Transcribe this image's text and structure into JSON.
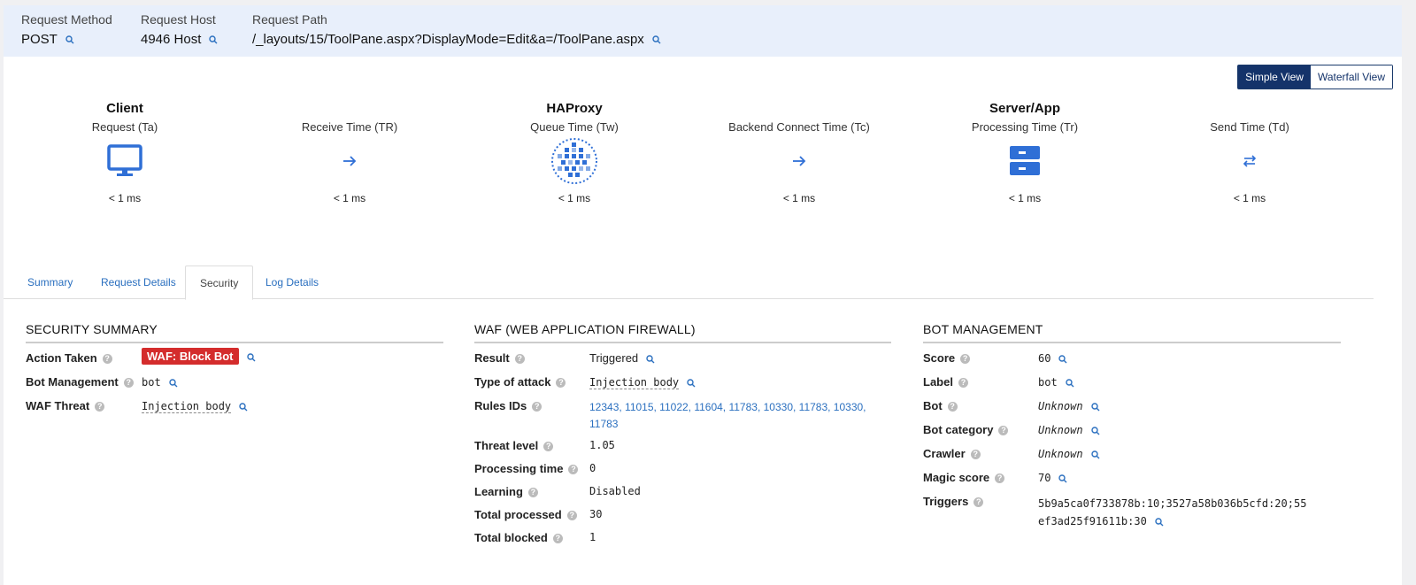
{
  "request": {
    "method": {
      "label": "Request Method",
      "value": "POST"
    },
    "host": {
      "label": "Request Host",
      "value": "4946 Host"
    },
    "path": {
      "label": "Request Path",
      "value": "/_layouts/15/ToolPane.aspx?DisplayMode=Edit&a=/ToolPane.aspx"
    }
  },
  "view_toggle": {
    "simple": "Simple View",
    "waterfall": "Waterfall View",
    "active": "simple"
  },
  "flow": [
    {
      "name": "Client",
      "sub": "Request (Ta)",
      "icon": "monitor-icon",
      "time": "< 1 ms"
    },
    {
      "name": "",
      "sub": "Receive Time (TR)",
      "icon": "arrow-right-icon",
      "time": "< 1 ms"
    },
    {
      "name": "HAProxy",
      "sub": "Queue Time (Tw)",
      "icon": "haproxy-logo-icon",
      "time": "< 1 ms"
    },
    {
      "name": "",
      "sub": "Backend Connect Time (Tc)",
      "icon": "arrow-right-icon",
      "time": "< 1 ms"
    },
    {
      "name": "Server/App",
      "sub": "Processing Time (Tr)",
      "icon": "server-icon",
      "time": "< 1 ms"
    },
    {
      "name": "",
      "sub": "Send Time (Td)",
      "icon": "swap-arrows-icon",
      "time": "< 1 ms"
    }
  ],
  "colors": {
    "accent": "#2a6fbf",
    "navy": "#14336a",
    "icon_blue": "#2f6fd6",
    "badge_red": "#d42c2c",
    "header_bg": "#e8effb"
  },
  "tabs": [
    "Summary",
    "Request Details",
    "Security",
    "Log Details"
  ],
  "active_tab": "Security",
  "security_summary": {
    "title": "SECURITY SUMMARY",
    "action_taken": {
      "label": "Action Taken",
      "value": "WAF: Block Bot"
    },
    "bot_management": {
      "label": "Bot Management",
      "value": "bot"
    },
    "waf_threat": {
      "label": "WAF Threat",
      "value": "Injection body"
    }
  },
  "waf": {
    "title": "WAF (WEB APPLICATION FIREWALL)",
    "result": {
      "label": "Result",
      "value": "Triggered"
    },
    "type_of_attack": {
      "label": "Type of attack",
      "value": "Injection body"
    },
    "rules_ids": {
      "label": "Rules IDs",
      "line1": "12343, 11015, 11022, 11604, 11783, 10330, 11783, 10330,",
      "line2": "11783"
    },
    "threat_level": {
      "label": "Threat level",
      "value": "1.05"
    },
    "processing_time": {
      "label": "Processing time",
      "value": "0"
    },
    "learning": {
      "label": "Learning",
      "value": "Disabled"
    },
    "total_processed": {
      "label": "Total processed",
      "value": "30"
    },
    "total_blocked": {
      "label": "Total blocked",
      "value": "1"
    }
  },
  "bot_management": {
    "title": "BOT MANAGEMENT",
    "score": {
      "label": "Score",
      "value": "60"
    },
    "label": {
      "label": "Label",
      "value": "bot"
    },
    "bot": {
      "label": "Bot",
      "value": "Unknown"
    },
    "bot_category": {
      "label": "Bot category",
      "value": "Unknown"
    },
    "crawler": {
      "label": "Crawler",
      "value": "Unknown"
    },
    "magic_score": {
      "label": "Magic score",
      "value": "70"
    },
    "triggers": {
      "label": "Triggers",
      "line1": "5b9a5ca0f733878b:10;3527a58b036b5cfd:20;55",
      "line2": "ef3ad25f91611b:30"
    }
  }
}
